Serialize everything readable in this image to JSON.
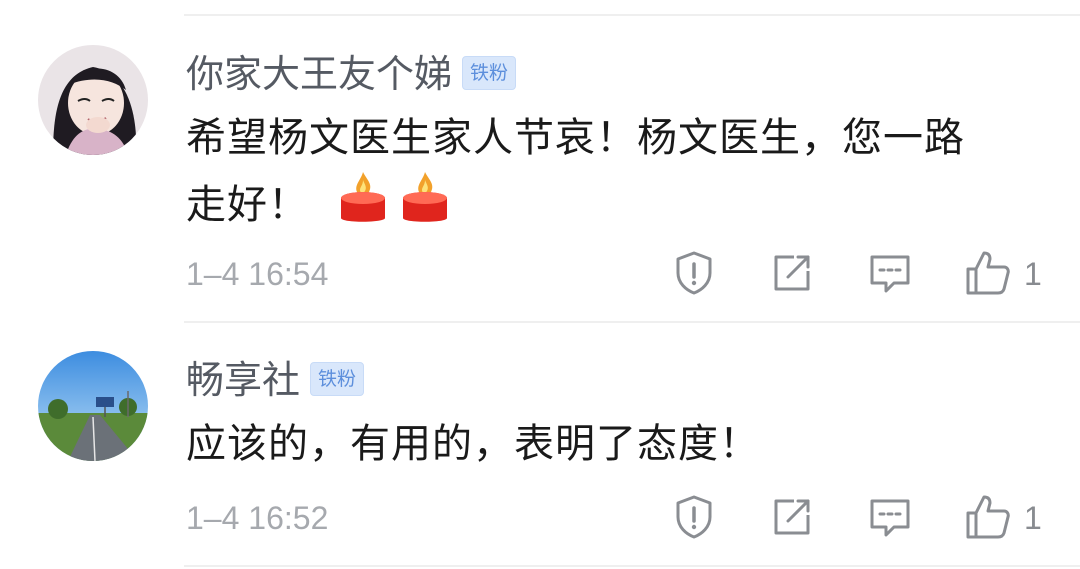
{
  "comments": [
    {
      "username": "你家大王友个娣",
      "badge": "铁粉",
      "text_line1": "希望杨文医生家人节哀！杨文医生，您一路",
      "text_line2": "走好！",
      "emojis": [
        "candle-emoji",
        "candle-emoji"
      ],
      "time": "1–4 16:54",
      "likes": "1"
    },
    {
      "username": "畅享社",
      "badge": "铁粉",
      "text_line1": "应该的，有用的，表明了态度！",
      "time": "1–4 16:52",
      "likes": "1"
    }
  ],
  "icons": {
    "report": "warning-shield-icon",
    "share": "share-out-icon",
    "reply": "comment-bubble-icon",
    "like": "thumbs-up-icon"
  },
  "colors": {
    "username": "#555a63",
    "badge_bg": "#d9e7fb",
    "badge_text": "#5d8fdc",
    "time": "#a6a9ae",
    "icon": "#8a8d92"
  }
}
